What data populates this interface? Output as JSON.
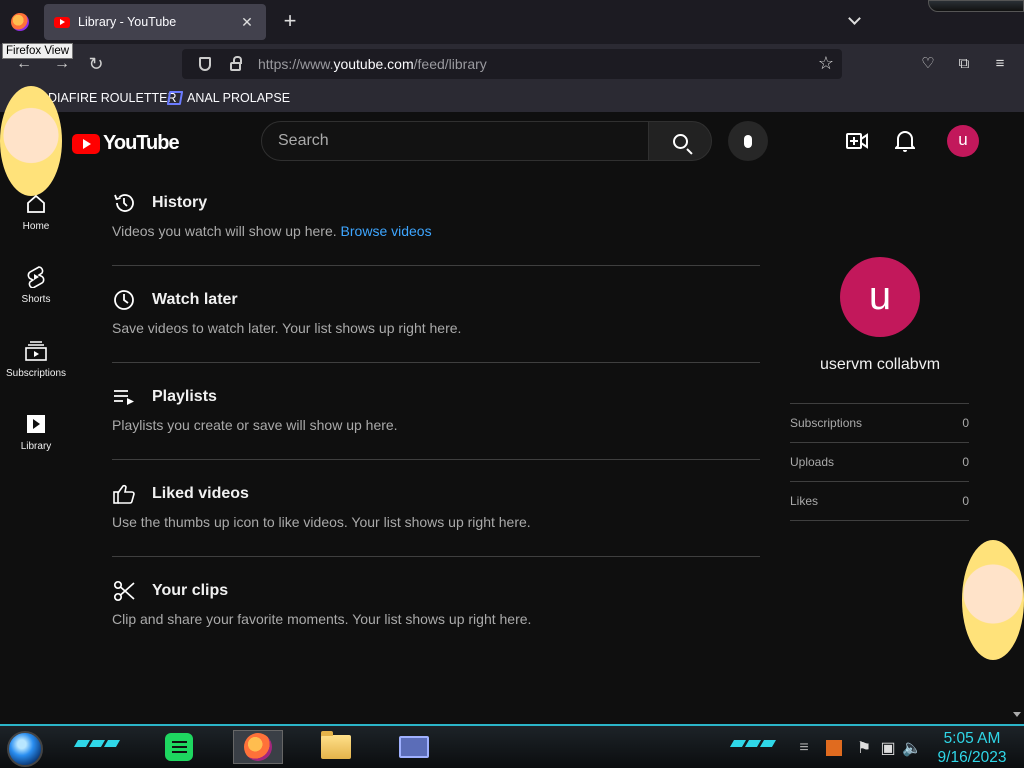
{
  "browser": {
    "tab_title": "Library - YouTube",
    "tooltip": "Firefox View",
    "url_prefix": "https://www.",
    "url_domain": "youtube.com",
    "url_path": "/feed/library",
    "bookmarks": [
      "DIAFIRE ROULETTER",
      "ANAL PROLAPSE"
    ]
  },
  "header": {
    "logo_text": "YouTube",
    "search_placeholder": "Search",
    "avatar_letter": "u"
  },
  "sidebar": {
    "items": [
      {
        "label": "Home"
      },
      {
        "label": "Shorts"
      },
      {
        "label": "Subscriptions"
      },
      {
        "label": "Library"
      }
    ]
  },
  "sections": [
    {
      "title": "History",
      "desc": "Videos you watch will show up here.",
      "link": "Browse videos"
    },
    {
      "title": "Watch later",
      "desc": "Save videos to watch later. Your list shows up right here."
    },
    {
      "title": "Playlists",
      "desc": "Playlists you create or save will show up here."
    },
    {
      "title": "Liked videos",
      "desc": "Use the thumbs up icon to like videos. Your list shows up right here."
    },
    {
      "title": "Your clips",
      "desc": "Clip and share your favorite moments. Your list shows up right here."
    }
  ],
  "profile": {
    "avatar_letter": "u",
    "name": "uservm collabvm",
    "stats": [
      {
        "label": "Subscriptions",
        "value": "0"
      },
      {
        "label": "Uploads",
        "value": "0"
      },
      {
        "label": "Likes",
        "value": "0"
      }
    ]
  },
  "taskbar": {
    "time": "5:05 AM",
    "date": "9/16/2023"
  },
  "colors": {
    "accent_red": "#ff0000",
    "avatar": "#c2185b",
    "link": "#3ea6ff",
    "taskbar_teal": "#2fd7e8"
  }
}
